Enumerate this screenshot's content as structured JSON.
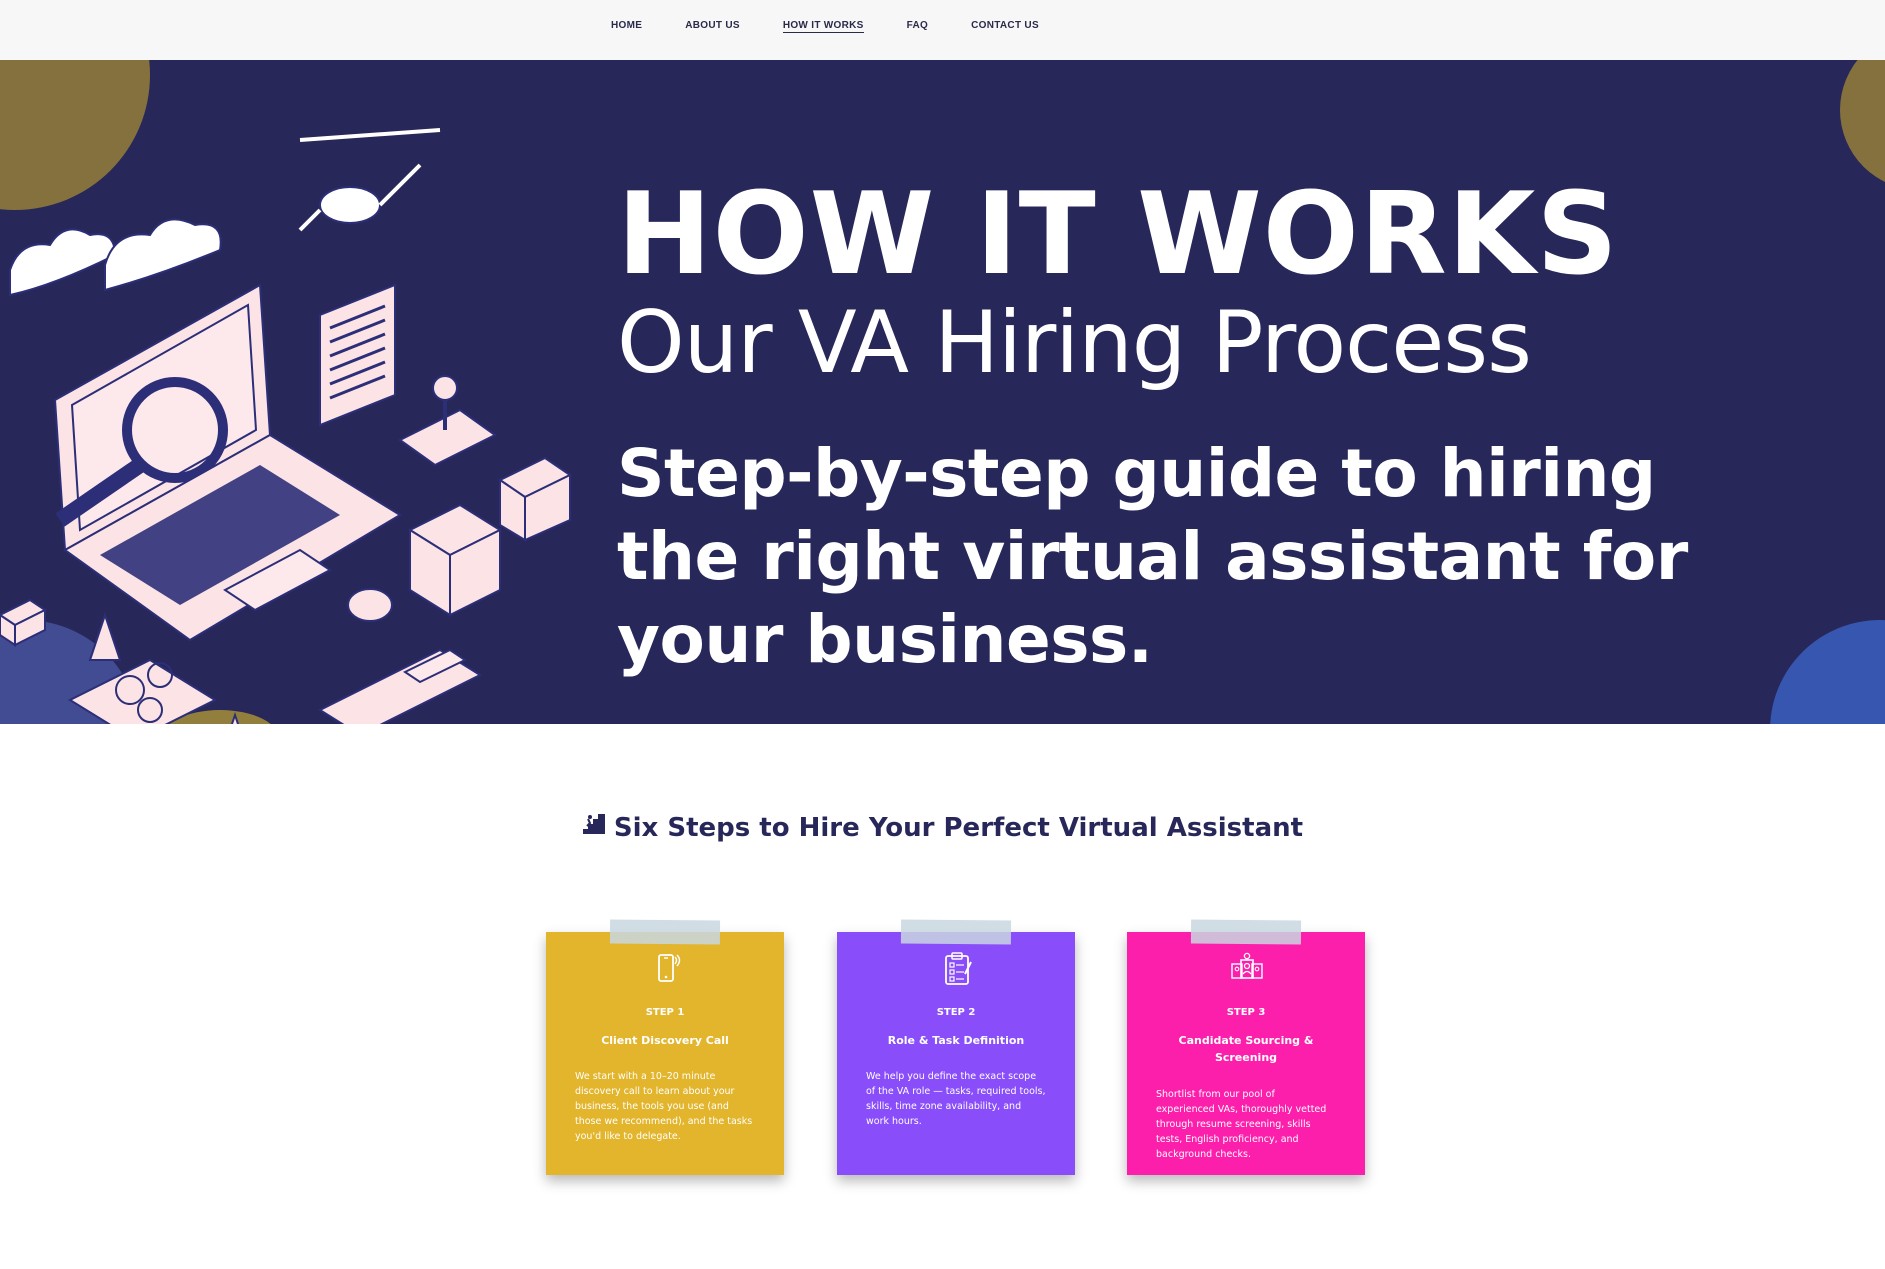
{
  "nav": {
    "items": [
      {
        "label": "HOME",
        "active": false
      },
      {
        "label": "ABOUT US",
        "active": false
      },
      {
        "label": "HOW IT WORKS",
        "active": true
      },
      {
        "label": "FAQ",
        "active": false
      },
      {
        "label": "CONTACT US",
        "active": false
      }
    ]
  },
  "hero": {
    "title": "HOW IT WORKS",
    "subtitle": "Our VA Hiring Process",
    "tagline": "Step-by-step guide to hiring the right virtual assistant for your business.",
    "background_color": "#27275a",
    "illustration": "isometric-laptop-tech-illustration"
  },
  "steps_section": {
    "heading_icon": "climbing-stairs-icon",
    "heading": "Six Steps to Hire Your Perfect Virtual Assistant",
    "cards": [
      {
        "icon": "smartphone-icon",
        "step": "STEP 1",
        "title": "Client Discovery Call",
        "description": "We start with a 10–20 minute discovery call to learn about your business, the tools you use (and those we recommend), and the tasks you'd like to delegate.",
        "color": "#e2b52c"
      },
      {
        "icon": "clipboard-checklist-icon",
        "step": "STEP 2",
        "title": "Role & Task Definition",
        "description": "We help you define the exact scope of the VA role — tasks, required tools, skills, time zone availability, and work hours.",
        "color": "#8a4dfa"
      },
      {
        "icon": "candidate-profiles-icon",
        "step": "STEP 3",
        "title": "Candidate Sourcing & Screening",
        "description": "Shortlist from our pool of experienced VAs, thoroughly vetted through resume screening, skills tests, English proficiency, and background checks.",
        "color": "#fc1fab"
      }
    ]
  }
}
